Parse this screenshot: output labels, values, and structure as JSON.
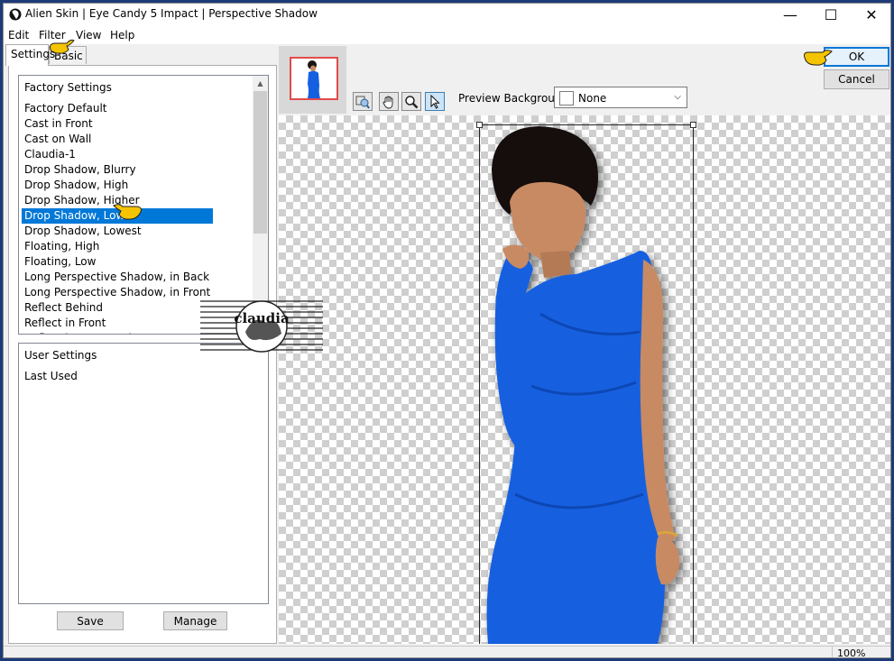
{
  "window": {
    "title": "Alien Skin | Eye Candy 5 Impact | Perspective Shadow",
    "minimize_glyph": "—",
    "maximize_glyph": "☐",
    "close_glyph": "✕"
  },
  "menu": [
    "Edit",
    "Filter",
    "View",
    "Help"
  ],
  "tabs": [
    {
      "label": "Settings",
      "active": true
    },
    {
      "label": "Basic",
      "active": false
    }
  ],
  "factory_settings": {
    "header": "Factory Settings",
    "selected": "Drop Shadow, Low",
    "items": [
      "Factory Default",
      "Cast in Front",
      "Cast on Wall",
      "Claudia-1",
      "Drop Shadow, Blurry",
      "Drop Shadow, High",
      "Drop Shadow, Higher",
      "Drop Shadow, Low",
      "Drop Shadow, Lowest",
      "Floating, High",
      "Floating, Low",
      "Long Perspective Shadow, in Back",
      "Long Perspective Shadow, in Front",
      "Reflect Behind",
      "Reflect in Front",
      "Reflect in Front - Faint"
    ]
  },
  "user_settings": {
    "header": "User Settings",
    "items": [
      "Last Used"
    ]
  },
  "buttons": {
    "save": "Save",
    "manage": "Manage",
    "ok": "OK",
    "cancel": "Cancel"
  },
  "preview": {
    "background_label": "Preview Background:",
    "background_value": "None",
    "zoom": "100%"
  },
  "toolbar_icons": [
    "zoom-fit-icon",
    "hand-icon",
    "magnifier-icon",
    "arrow-pointer-icon"
  ],
  "watermark_text": "claudia",
  "colors": {
    "selection": "#0078d7",
    "dress": "#1560e0",
    "pointer": "#f5c400"
  }
}
